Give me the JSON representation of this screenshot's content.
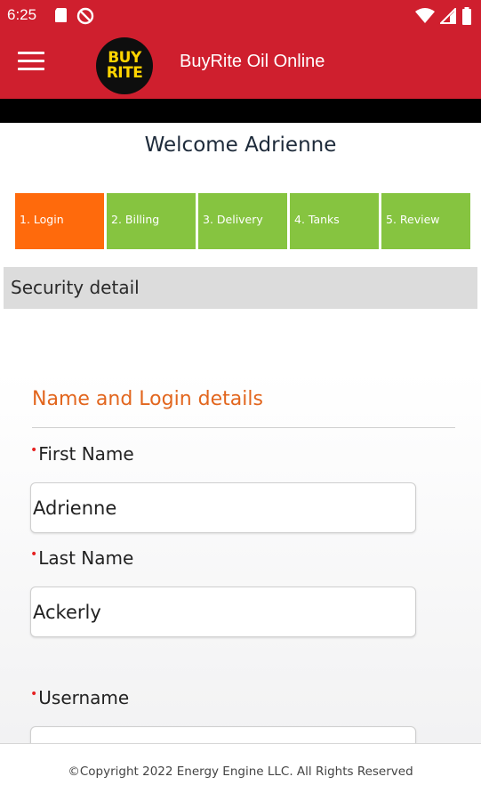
{
  "status_bar": {
    "time": "6:25",
    "left_icons": [
      "sd-card-icon",
      "do-not-disturb-icon"
    ],
    "right_icons": [
      "wifi-icon",
      "cell-signal-icon",
      "battery-icon"
    ]
  },
  "app_bar": {
    "title": "BuyRite Oil Online",
    "logo_line1": "BUY",
    "logo_line2": "RITE",
    "color": "#cf1f2e"
  },
  "welcome": "Welcome Adrienne",
  "steps": [
    {
      "label": "1. Login",
      "active": true
    },
    {
      "label": "2. Billing",
      "active": false
    },
    {
      "label": "3. Delivery",
      "active": false
    },
    {
      "label": "4. Tanks",
      "active": false
    },
    {
      "label": "5. Review",
      "active": false
    }
  ],
  "step_colors": {
    "active": "#ff6a0c",
    "inactive": "#86c440"
  },
  "section_title": "Security detail",
  "form": {
    "heading": "Name and Login details",
    "required_marker": "•",
    "first_name": {
      "label": "First Name",
      "value": "Adrienne"
    },
    "last_name": {
      "label": "Last Name",
      "value": "Ackerly"
    },
    "username": {
      "label": "Username",
      "value": ""
    }
  },
  "footer": "©Copyright 2022 Energy Engine LLC. All Rights Reserved"
}
